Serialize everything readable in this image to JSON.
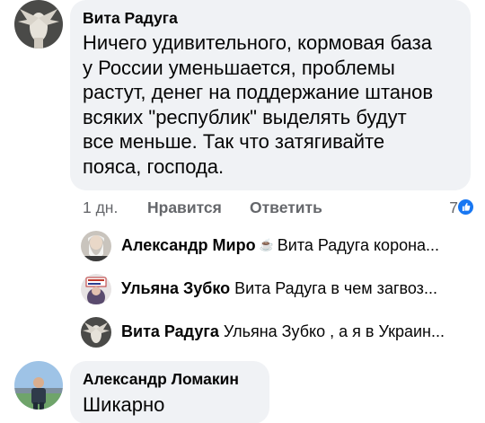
{
  "comment1": {
    "author": "Вита Радуга",
    "lines": [
      "Ничего удивительного, кормовая база",
      "у России уменьшается, проблемы",
      "растут, денег на поддержание штанов",
      "всяких \"республик\" выделять будут",
      "все меньше. Так что затягивайте",
      "пояса, господа."
    ],
    "time": "1 дн.",
    "like_label": "Нравится",
    "reply_label": "Ответить",
    "reaction_count": "7",
    "reaction_icon": "thumbs-up-icon"
  },
  "replies": [
    {
      "author": "Александр Миро",
      "text": "Вита Радуга корона...",
      "icon": "cup-icon"
    },
    {
      "author": "Ульяна Зубко",
      "text": "Вита Радуга в чем загвоз..."
    },
    {
      "author": "Вита Радуга",
      "text": "Ульяна Зубко , а я в Украин..."
    }
  ],
  "comment2": {
    "author": "Александр Ломакин",
    "text": "Шикарно"
  },
  "colors": {
    "bubble": "#f0f2f5",
    "secondary_text": "#65676b",
    "like_blue": "#1877f2"
  }
}
